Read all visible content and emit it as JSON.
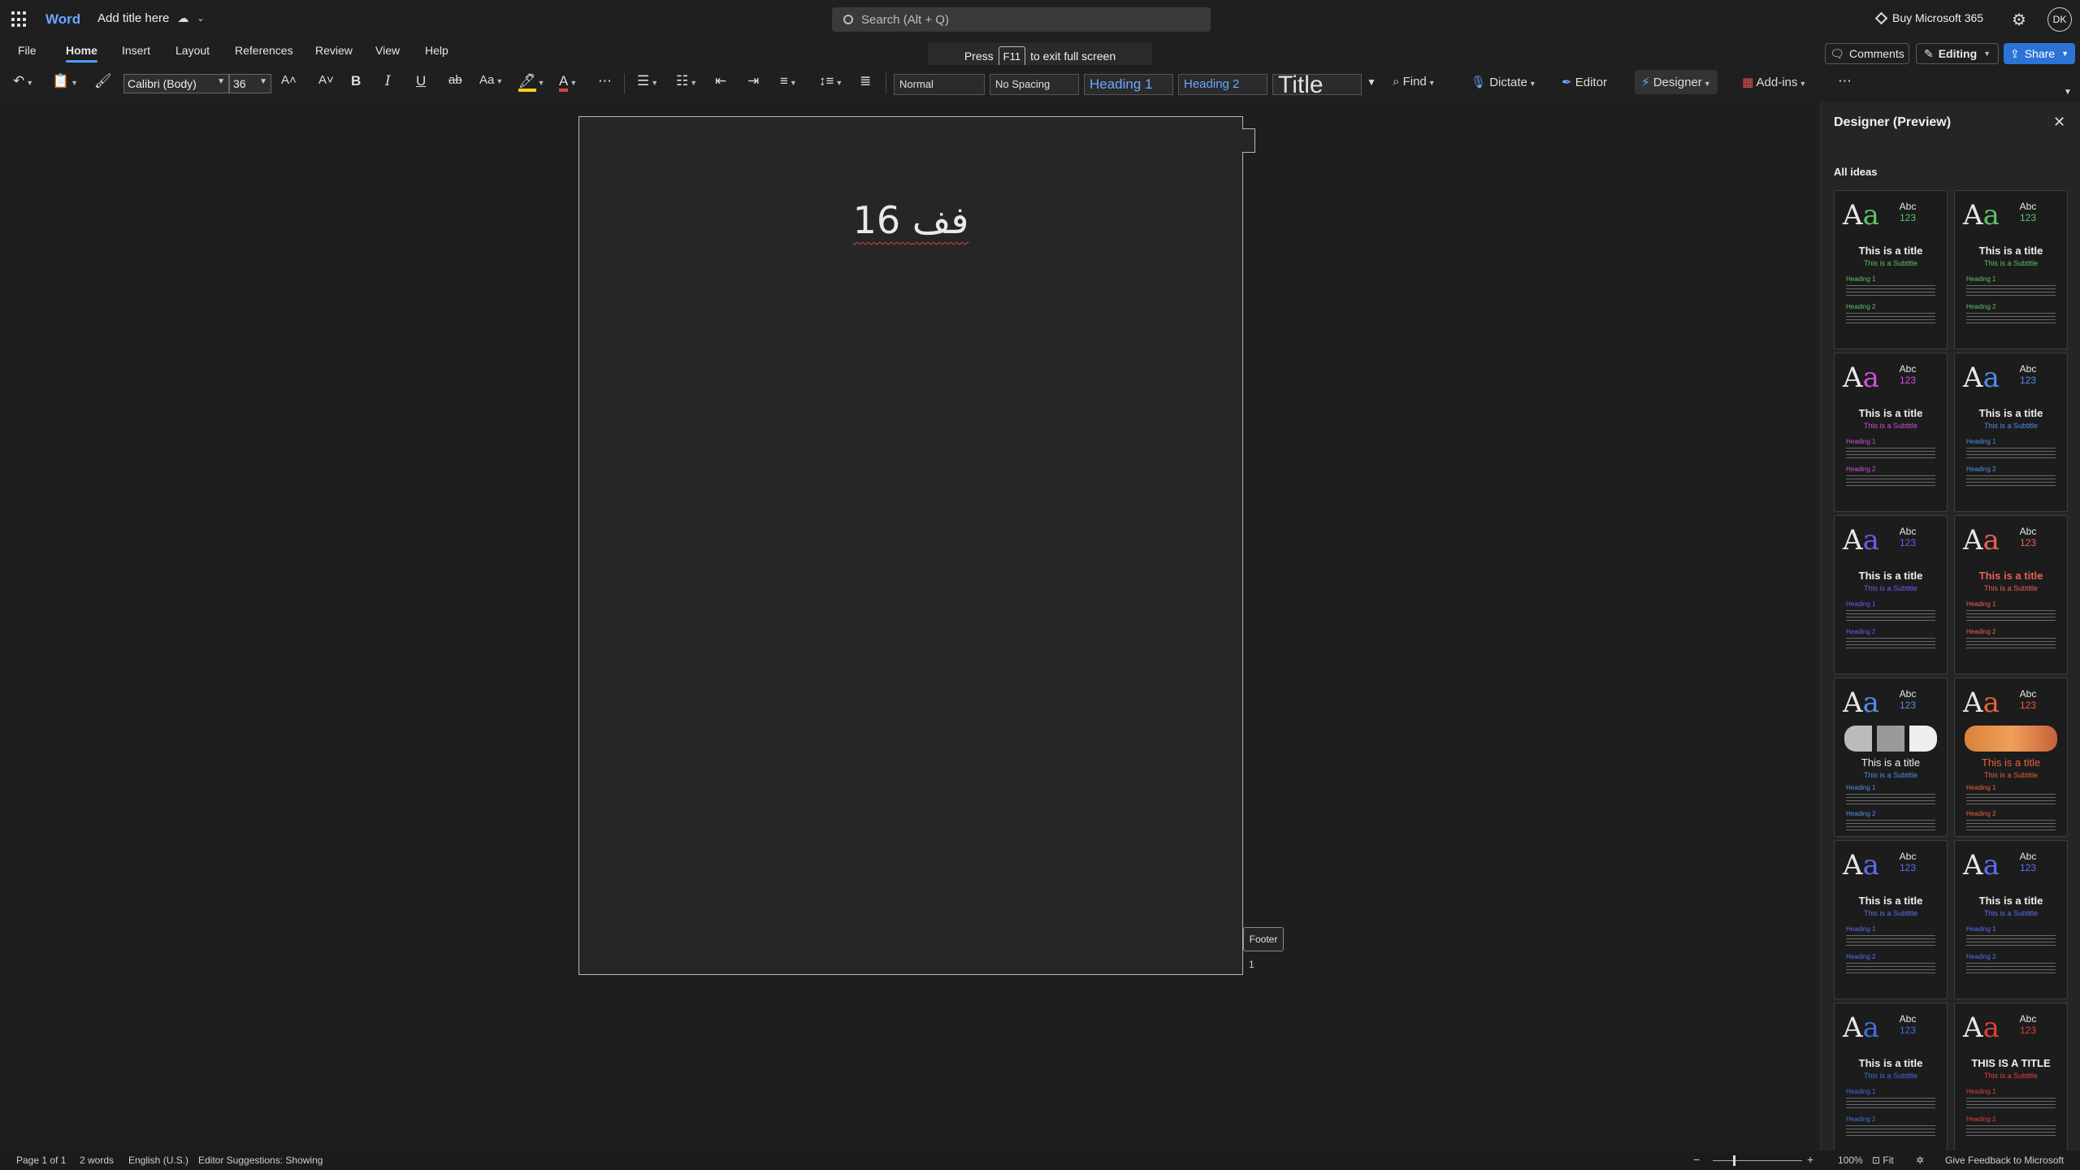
{
  "titlebar": {
    "app_name": "Word",
    "doc_title": "Add title here",
    "search_placeholder": "Search (Alt + Q)",
    "buy_label": "Buy Microsoft 365",
    "avatar_initials": "DK"
  },
  "tabs": [
    "File",
    "Home",
    "Insert",
    "Layout",
    "References",
    "Review",
    "View",
    "Help"
  ],
  "active_tab": "Home",
  "header_buttons": {
    "comments": "Comments",
    "editing": "Editing",
    "share": "Share"
  },
  "toast": {
    "prefix": "Press",
    "key": "F11",
    "suffix": "to exit full screen"
  },
  "ribbon": {
    "font_name": "Calibri (Body)",
    "font_size": "36",
    "styles": [
      "Normal",
      "No Spacing",
      "Heading 1",
      "Heading 2",
      "Title"
    ],
    "find_label": "Find",
    "dictate_label": "Dictate",
    "editor_label": "Editor",
    "designer_label": "Designer",
    "addins_label": "Add-ins",
    "highlight_color": "#f2d21b",
    "font_color": "#e04040"
  },
  "document": {
    "heading": "16 فف",
    "footer_label": "Footer",
    "page_number": "1"
  },
  "designer": {
    "title": "Designer (Preview)",
    "section": "All ideas",
    "ideas": [
      {
        "title": "This is a title",
        "subtitle": "This is a Subtitle",
        "accent": "#5cc266",
        "heading_color": "#5cc266"
      },
      {
        "title": "This is a title",
        "subtitle": "This is a Subtitle",
        "accent": "#5cc266",
        "heading_color": "#5cc266"
      },
      {
        "title": "This is a title",
        "subtitle": "This is a Subtitle",
        "accent": "#d34fd6",
        "heading_color": "#d34fd6"
      },
      {
        "title": "This is a title",
        "subtitle": "This is a Subtitle",
        "accent": "#4f8fe6",
        "heading_color": "#4f8fe6"
      },
      {
        "title": "This is a title",
        "subtitle": "This is a Subtitle",
        "accent": "#6d5bf0",
        "heading_color": "#6d5bf0"
      },
      {
        "title": "This is a title",
        "subtitle": "This is a Subtitle",
        "accent": "#e8605a",
        "heading_color": "#e8605a"
      },
      {
        "title": "This is a title",
        "subtitle": "This is a Subtitle",
        "accent": "#4f8fe6",
        "heading_color": "#4f8fe6"
      },
      {
        "title": "This is a title",
        "subtitle": "This is a Subtitle",
        "accent": "#e8603a",
        "heading_color": "#e8603a"
      },
      {
        "title": "This is a title",
        "subtitle": "This is a Subtitle",
        "accent": "#5a6ff0",
        "heading_color": "#5a6ff0"
      },
      {
        "title": "This is a title",
        "subtitle": "This is a Subtitle",
        "accent": "#5a6ff0",
        "heading_color": "#5a6ff0"
      },
      {
        "title": "This is a title",
        "subtitle": "This is a Subtitle",
        "accent": "#3f6fe0",
        "heading_color": "#3f6fe0"
      },
      {
        "title": "THIS IS A TITLE",
        "subtitle": "This is a Subtitle",
        "accent": "#e0403a",
        "heading_color": "#e0403a"
      }
    ]
  },
  "status": {
    "page": "Page 1 of 1",
    "words": "2 words",
    "language": "English (U.S.)",
    "editor_suggestions": "Editor Suggestions: Showing",
    "zoom": "100%",
    "fit": "Fit",
    "feedback": "Give Feedback to Microsoft"
  }
}
